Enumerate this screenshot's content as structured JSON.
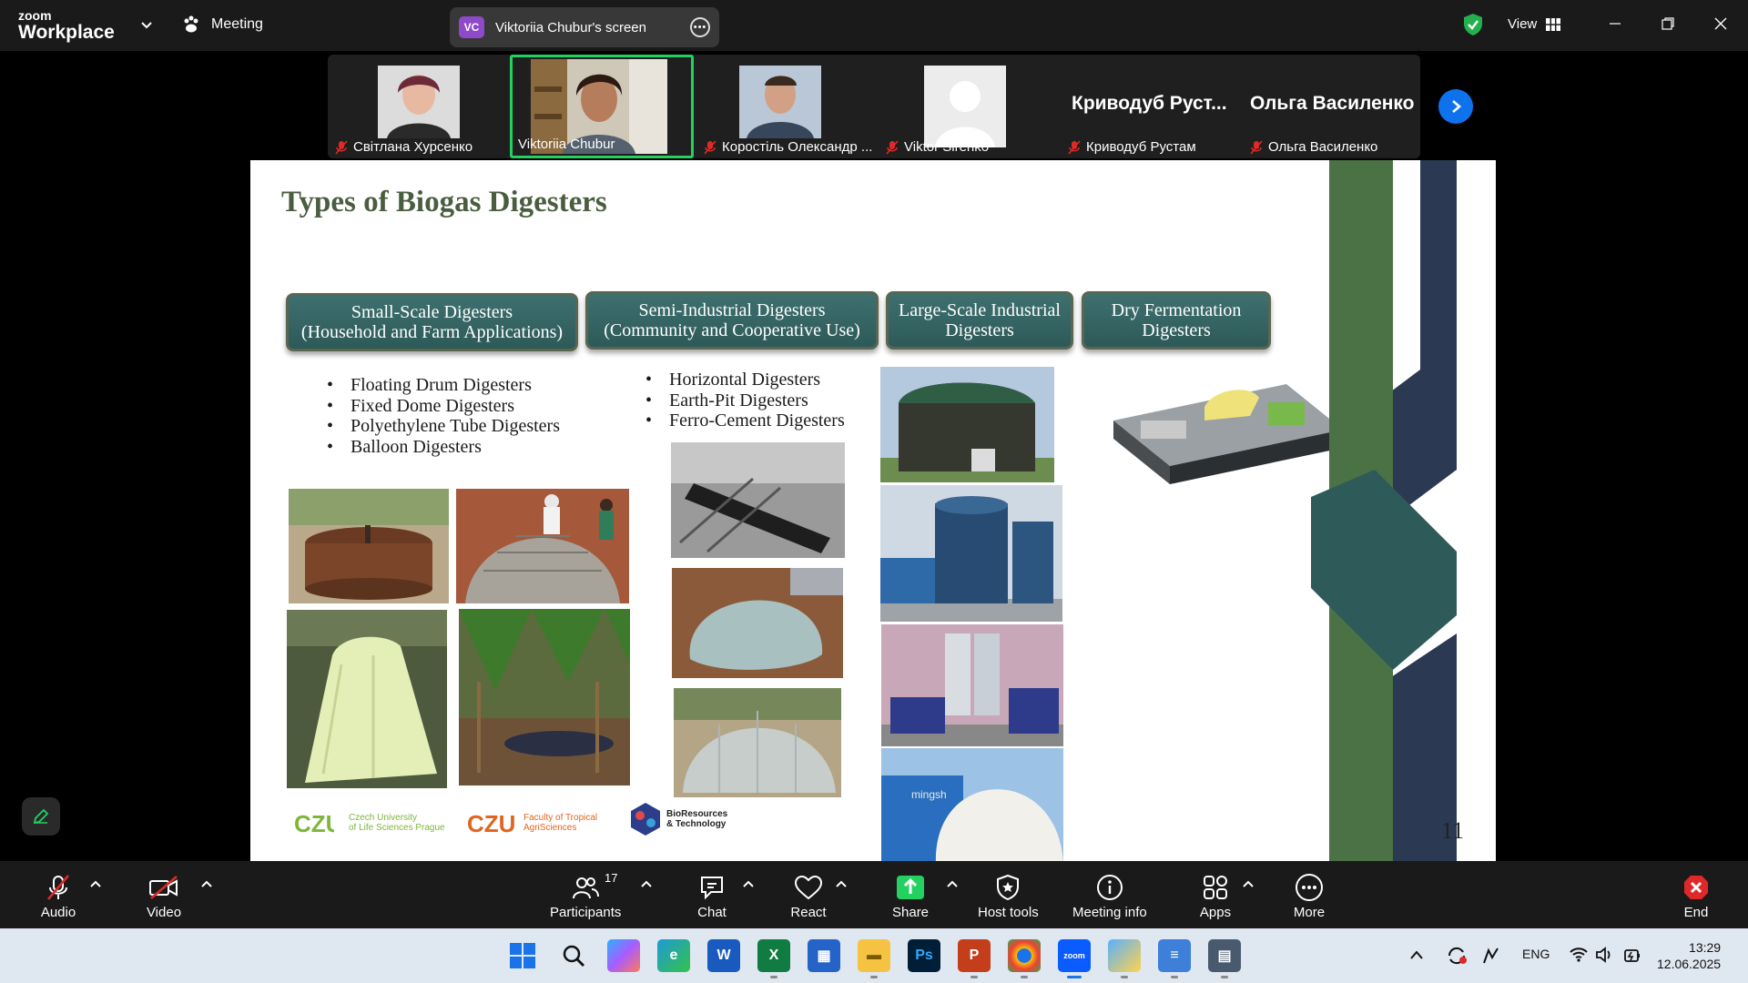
{
  "topbar": {
    "brand_top": "zoom",
    "brand_bottom": "Workplace",
    "meeting_label": "Meeting",
    "screen_badge": "VC",
    "screen_title": "Viktoriia Chubur's screen",
    "view_label": "View"
  },
  "participants": [
    {
      "name": "Світлана Хурсенко",
      "muted": true
    },
    {
      "name": "Viktoriia Chubur",
      "muted": false,
      "active": true
    },
    {
      "name": "Коростіль Олександр ...",
      "muted": true
    },
    {
      "name": "Viktor  Sirenko",
      "muted": true
    },
    {
      "name": "Криводуб Рустам",
      "display": "Криводуб  Руст...",
      "muted": true
    },
    {
      "name": "Ольга Василенко",
      "display": "Ольга Василенко",
      "muted": true
    }
  ],
  "slide": {
    "title": "Types of Biogas Digesters",
    "categories": [
      {
        "line1": "Small-Scale Digesters",
        "line2": "(Household and Farm Applications)"
      },
      {
        "line1": "Semi-Industrial Digesters",
        "line2": "(Community and Cooperative Use)"
      },
      {
        "line1": "Large-Scale Industrial",
        "line2": "Digesters"
      },
      {
        "line1": "Dry Fermentation",
        "line2": "Digesters"
      }
    ],
    "small_scale_list": [
      "Floating Drum Digesters",
      "Fixed Dome Digesters",
      "Polyethylene Tube Digesters",
      "Balloon Digesters"
    ],
    "semi_industrial_list": [
      "Horizontal Digesters",
      "Earth-Pit Digesters",
      "Ferro-Cement Digesters"
    ],
    "logos": {
      "czu1_l1": "Czech University",
      "czu1_l2": "of Life Sciences Prague",
      "czu2_l1": "Faculty of Tropical",
      "czu2_l2": "AgriSciences",
      "bio_l1": "BioResources",
      "bio_l2": "& Technology",
      "watermark": "mingsh"
    },
    "page_number": "11"
  },
  "toolbar": {
    "audio": "Audio",
    "video": "Video",
    "participants": "Participants",
    "participants_count": "17",
    "chat": "Chat",
    "react": "React",
    "share": "Share",
    "host_tools": "Host tools",
    "meeting_info": "Meeting info",
    "apps": "Apps",
    "more": "More",
    "end": "End"
  },
  "taskbar": {
    "lang": "ENG",
    "time": "13:29",
    "date": "12.06.2025"
  },
  "colors": {
    "active_speaker": "#23d160",
    "share_green": "#23d160",
    "slide_title": "#4a5e3f",
    "category_box": "#2d5a59",
    "zoom_blue": "#0e72ed",
    "end_red": "#e02828"
  }
}
